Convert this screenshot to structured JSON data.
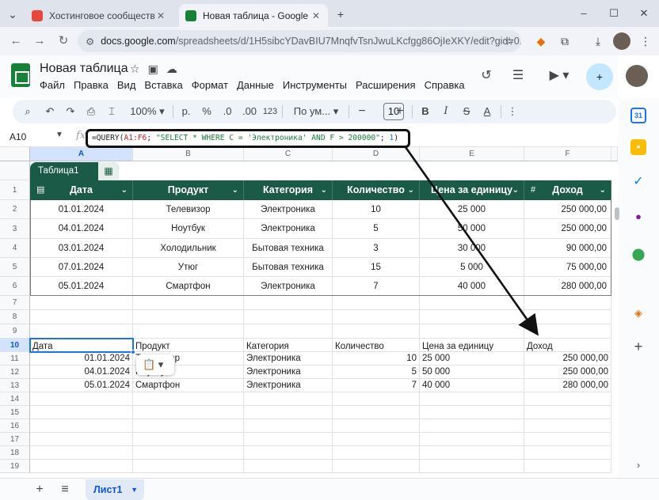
{
  "browser": {
    "tabs": [
      {
        "title": "Хостинговое сообщество «Tim",
        "active": false
      },
      {
        "title": "Новая таблица - Google Табли",
        "active": true
      }
    ],
    "url_host": "docs.google.com",
    "url_path": "/spreadsheets/d/1H5sibcYDavBIU7MnqfvTsnJwuLKcfgg86OjIeXKY/edit?gid=0..."
  },
  "sheet": {
    "title": "Новая таблица",
    "menu": [
      "Файл",
      "Правка",
      "Вид",
      "Вставка",
      "Формат",
      "Данные",
      "Инструменты",
      "Расширения",
      "Справка"
    ]
  },
  "toolbar": {
    "zoom": "100%",
    "currency": "р.",
    "percent": "%",
    "dec_less": ".0",
    "dec_more": ".00",
    "numfmt": "123",
    "font": "По ум...",
    "font_size": "10"
  },
  "formula_bar": {
    "name_box": "A10",
    "fx": "fx",
    "formula_parts": {
      "p1": "=QUERY(",
      "range": "A1:F6",
      "p2": "; ",
      "query": "\"SELECT * WHERE C = 'Электроника' AND F > 200000\"",
      "p3": "; ",
      "headers": "1",
      "p4": ")"
    }
  },
  "grid": {
    "columns": [
      "A",
      "B",
      "C",
      "D",
      "E",
      "F"
    ],
    "rows": [
      "1",
      "2",
      "3",
      "4",
      "5",
      "6",
      "7",
      "8",
      "9",
      "10",
      "11",
      "12",
      "13",
      "14",
      "15",
      "16",
      "17",
      "18",
      "19"
    ],
    "table_name": "Таблица1",
    "table_headers": [
      "Дата",
      "Продукт",
      "Категория",
      "Количество",
      "Цена за единицу",
      "Доход"
    ],
    "table_rows": [
      [
        "01.01.2024",
        "Телевизор",
        "Электроника",
        "10",
        "25 000",
        "250 000,00"
      ],
      [
        "04.01.2024",
        "Ноутбук",
        "Электроника",
        "5",
        "50 000",
        "250 000,00"
      ],
      [
        "03.01.2024",
        "Холодильник",
        "Бытовая техника",
        "3",
        "30 000",
        "90 000,00"
      ],
      [
        "07.01.2024",
        "Утюг",
        "Бытовая техника",
        "15",
        "5 000",
        "75 000,00"
      ],
      [
        "05.01.2024",
        "Смартфон",
        "Электроника",
        "7",
        "40 000",
        "280 000,00"
      ]
    ],
    "query_headers": [
      "Дата",
      "Продукт",
      "Категория",
      "Количество",
      "Цена за единицу",
      "Доход"
    ],
    "query_rows": [
      [
        "01.01.2024",
        "Телевизор",
        "Электроника",
        "10",
        "25 000",
        "250 000,00"
      ],
      [
        "04.01.2024",
        "Ноутбук",
        "Электроника",
        "5",
        "50 000",
        "250 000,00"
      ],
      [
        "05.01.2024",
        "Смартфон",
        "Электроника",
        "7",
        "40 000",
        "280 000,00"
      ]
    ]
  },
  "bottom": {
    "sheet_tab": "Лист1"
  }
}
